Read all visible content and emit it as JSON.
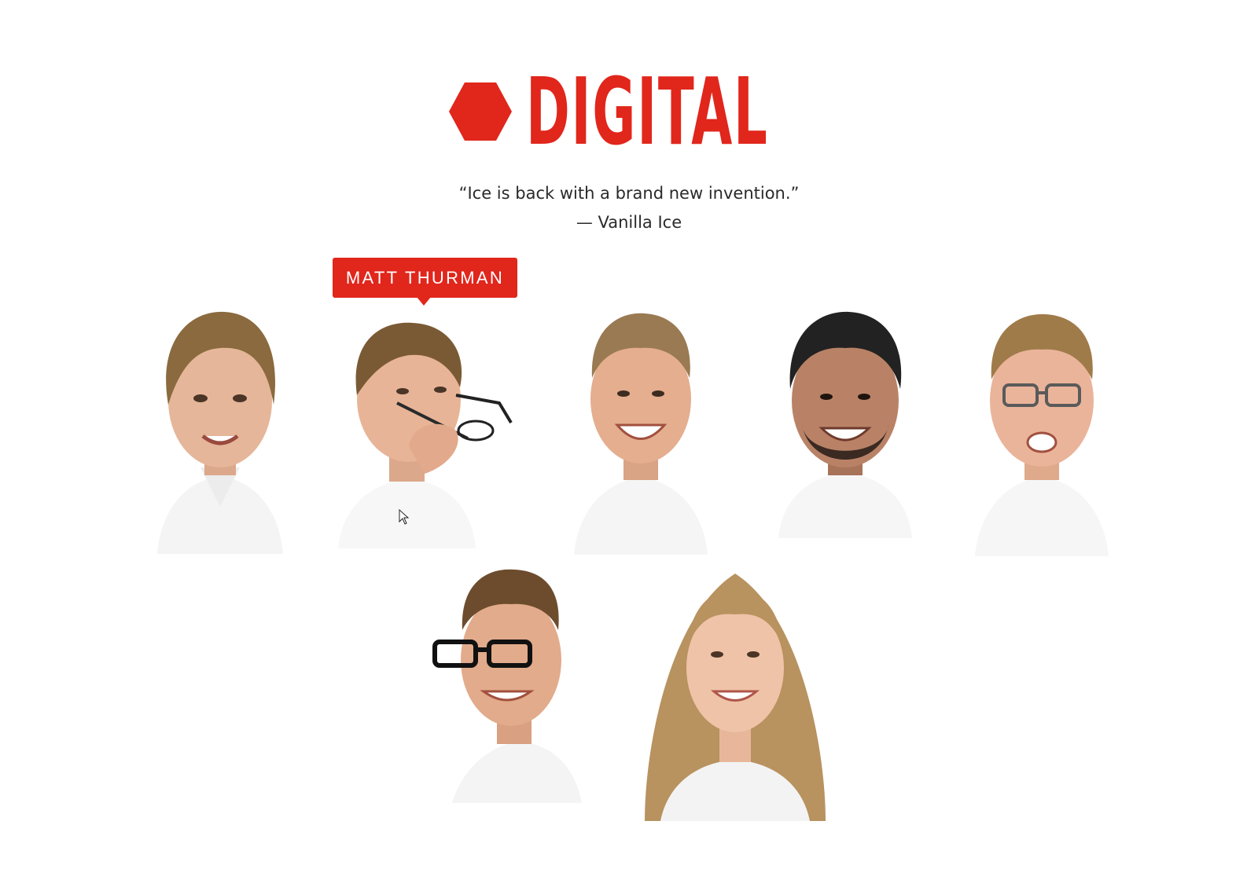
{
  "brand": {
    "name": "DIGITAL",
    "color": "#e1261c",
    "mark_icon": "hexagon-icon"
  },
  "quote": {
    "text": "“Ice is back with a brand new invention.”",
    "author": "— Vanilla Ice"
  },
  "tooltip": {
    "label": "MATT THURMAN",
    "color": "#e1261c"
  },
  "team": [
    {
      "id": "member-1",
      "hair": "#8a6a3e",
      "skin": "#e5b699",
      "shirt": "#f6f6f6",
      "glasses": false
    },
    {
      "id": "member-2",
      "hair": "#7a5a34",
      "skin": "#e8b497",
      "shirt": "#f7f7f7",
      "glasses": "in-hand",
      "hovered": true
    },
    {
      "id": "member-3",
      "hair": "#9a7a52",
      "skin": "#e4ae8f",
      "shirt": "#f5f5f5",
      "glasses": false
    },
    {
      "id": "member-4",
      "hair": "#222222",
      "skin": "#b98266",
      "shirt": "#f6f6f6",
      "glasses": false
    },
    {
      "id": "member-5",
      "hair": "#a07b4a",
      "skin": "#eab49a",
      "shirt": "#f6f6f6",
      "glasses": "grey"
    },
    {
      "id": "member-6",
      "hair": "#6d4c2e",
      "skin": "#e2ab8b",
      "shirt": "#f4f4f4",
      "glasses": "black"
    },
    {
      "id": "member-7",
      "hair": "#b8925f",
      "skin": "#efc3a8",
      "shirt": "#f3f3f3",
      "glasses": false
    }
  ]
}
